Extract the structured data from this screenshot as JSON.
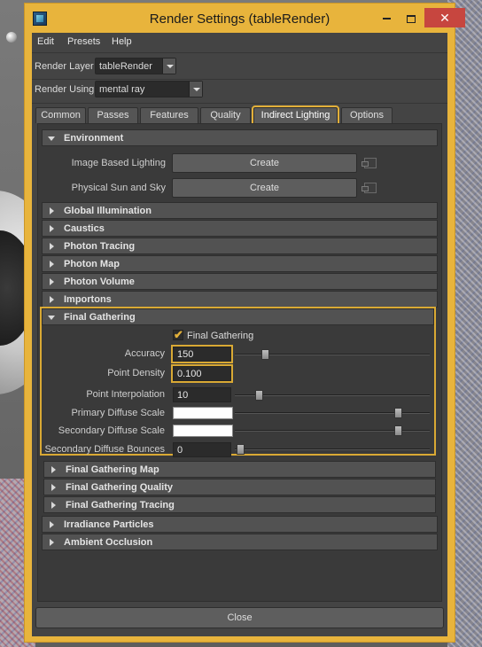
{
  "window": {
    "title": "Render Settings (tableRender)",
    "controls": {
      "minimize": "minimize-icon",
      "maximize": "maximize-icon",
      "close": "✕"
    }
  },
  "menubar": {
    "items": [
      "Edit",
      "Presets",
      "Help"
    ]
  },
  "render_layer": {
    "label": "Render Layer",
    "value": "tableRender"
  },
  "render_using": {
    "label": "Render Using",
    "value": "mental ray"
  },
  "tabs": [
    {
      "label": "Common",
      "active": false
    },
    {
      "label": "Passes",
      "active": false
    },
    {
      "label": "Features",
      "active": false
    },
    {
      "label": "Quality",
      "active": false
    },
    {
      "label": "Indirect Lighting",
      "active": true
    },
    {
      "label": "Options",
      "active": false
    }
  ],
  "environment": {
    "title": "Environment",
    "image_based_lighting": {
      "label": "Image Based Lighting",
      "button": "Create"
    },
    "physical_sun": {
      "label": "Physical Sun and Sky",
      "button": "Create"
    }
  },
  "collapsed_sections": [
    "Global Illumination",
    "Caustics",
    "Photon Tracing",
    "Photon Map",
    "Photon Volume",
    "Importons"
  ],
  "final_gathering": {
    "title": "Final Gathering",
    "checkbox_label": "Final Gathering",
    "checked": true,
    "fields": [
      {
        "label": "Accuracy",
        "value": "150",
        "slider": 0.12,
        "highlighted": true
      },
      {
        "label": "Point Density",
        "value": "0.100",
        "highlighted": true
      },
      {
        "label": "Point Interpolation",
        "value": "10",
        "slider": 0.1
      },
      {
        "label": "Primary Diffuse Scale",
        "value": "",
        "slider": 0.97,
        "color": "#ffffff"
      },
      {
        "label": "Secondary Diffuse Scale",
        "value": "",
        "slider": 0.97,
        "color": "#ffffff"
      },
      {
        "label": "Secondary Diffuse Bounces",
        "value": "0",
        "slider": 0.0
      }
    ],
    "subsections": [
      "Final Gathering Map",
      "Final Gathering Quality",
      "Final Gathering Tracing"
    ]
  },
  "trailing_sections": [
    "Irradiance Particles",
    "Ambient Occlusion"
  ],
  "close_button": "Close",
  "colors": {
    "highlight": "#d9a934",
    "window_frame": "#e8b43c",
    "close_control": "#c7463f",
    "panel": "#444444"
  }
}
